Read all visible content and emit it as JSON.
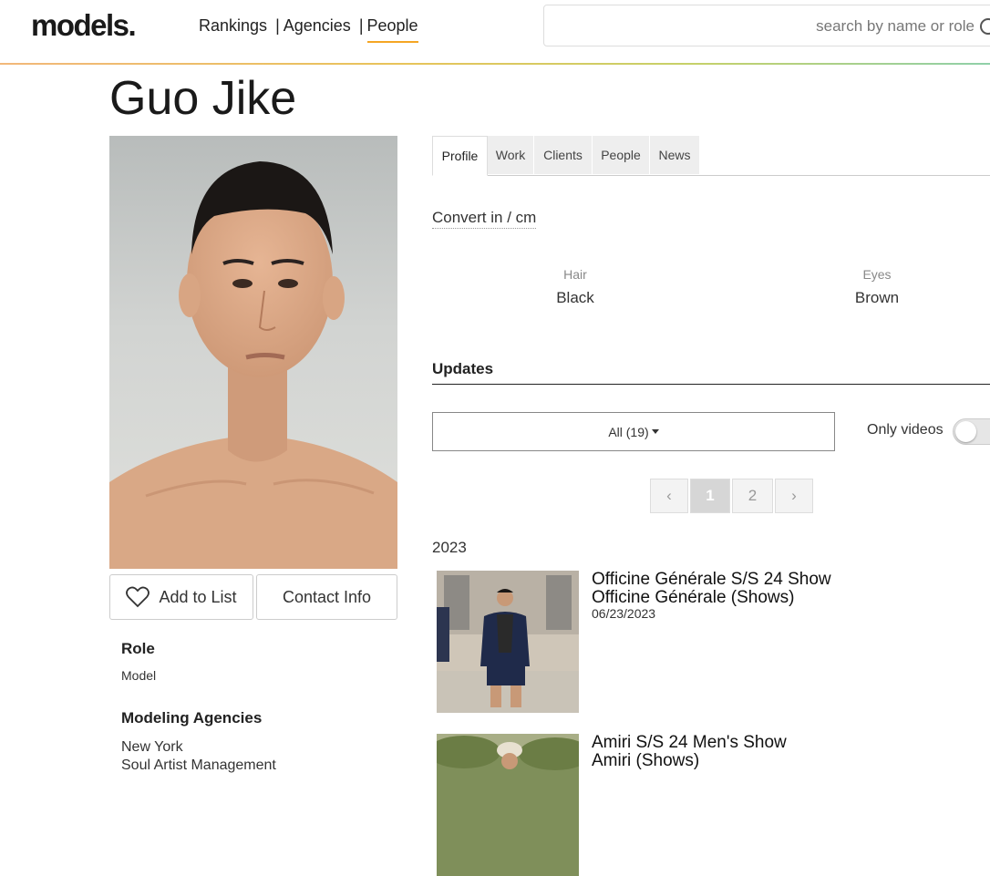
{
  "header": {
    "logo": "models.",
    "nav": {
      "rankings": "Rankings",
      "sep1": "|",
      "agencies": "Agencies",
      "sep2": "|",
      "people": "People"
    },
    "search_placeholder": "search by name or role"
  },
  "profile": {
    "name": "Guo Jike",
    "add_to_list": "Add to List",
    "contact_info": "Contact Info",
    "role_title": "Role",
    "role_value": "Model",
    "agencies_title": "Modeling Agencies",
    "agency_city": "New York",
    "agency_name": "Soul Artist Management"
  },
  "tabs": [
    "Profile",
    "Work",
    "Clients",
    "People",
    "News"
  ],
  "active_tab": "Profile",
  "convert_label": "Convert in / cm",
  "attributes": {
    "hair_label": "Hair",
    "hair_value": "Black",
    "eyes_label": "Eyes",
    "eyes_value": "Brown"
  },
  "updates": {
    "title": "Updates",
    "filter_label": "All (19)",
    "only_videos_label": "Only videos",
    "only_videos_on": false,
    "pagination": {
      "prev": "‹",
      "page1": "1",
      "page2": "2",
      "next": "›",
      "current": 1
    },
    "year": "2023",
    "items": [
      {
        "title": "Officine Générale S/S 24 Show",
        "brand": "Officine Générale (Shows)",
        "date": "06/23/2023"
      },
      {
        "title": "Amiri S/S 24 Men's Show",
        "brand": "Amiri (Shows)",
        "date": ""
      }
    ]
  },
  "colors": {
    "accent_underline": "#f5a623",
    "tab_bg": "#eeeeee"
  }
}
